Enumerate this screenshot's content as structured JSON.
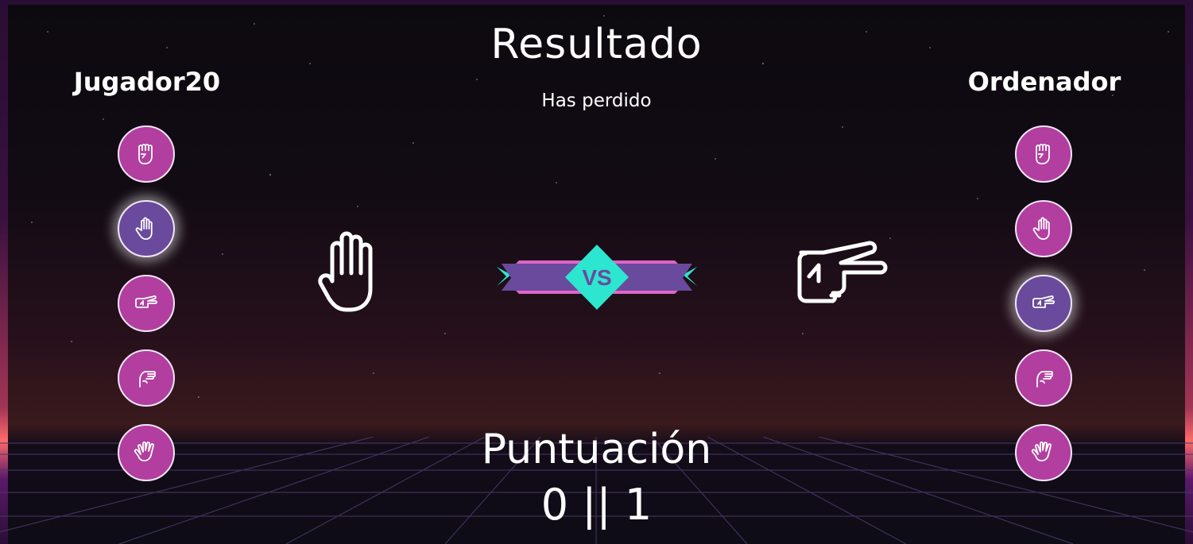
{
  "result": {
    "title": "Resultado",
    "message": "Has perdido"
  },
  "players": {
    "left": {
      "name": "Jugador20",
      "choices": [
        "rock",
        "paper",
        "scissors",
        "lizard",
        "spock"
      ],
      "selected": "paper"
    },
    "right": {
      "name": "Ordenador",
      "choices": [
        "rock",
        "paper",
        "scissors",
        "lizard",
        "spock"
      ],
      "selected": "scissors"
    }
  },
  "versus": {
    "label": "VS",
    "colors": {
      "banner": "#6a4a9c",
      "banner_edge": "#e065c8",
      "diamond": "#2ce6d0"
    }
  },
  "score": {
    "title": "Puntuación",
    "value": "0 || 1"
  },
  "colors": {
    "choice_bg": "#b23e9f",
    "choice_selected_bg": "#6a4a9c",
    "text": "#ffffff"
  }
}
